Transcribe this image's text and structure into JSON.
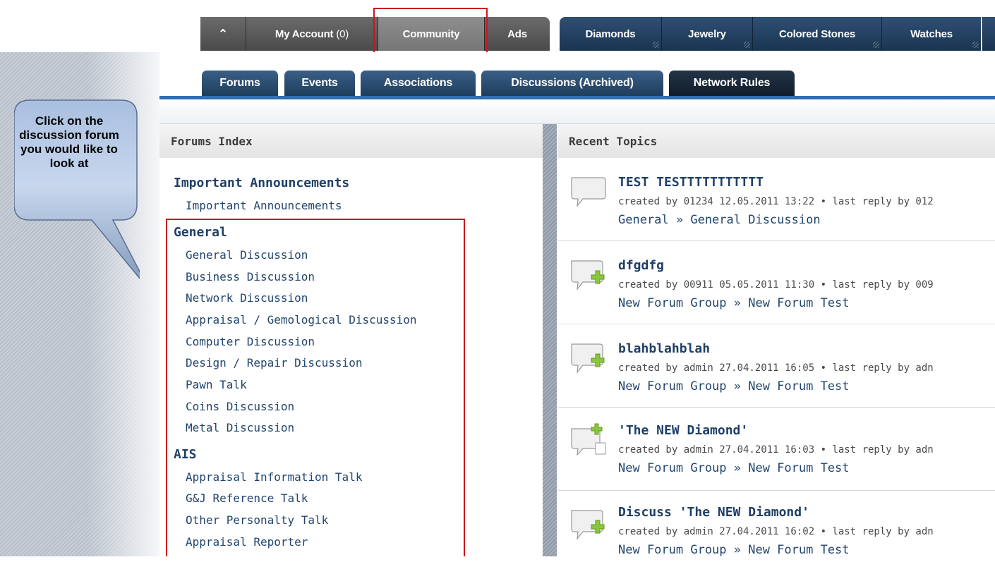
{
  "nav": {
    "my_account_label": "My Account",
    "my_account_count": "(0)",
    "community_label": "Community",
    "ads_label": "Ads",
    "diamonds_label": "Diamonds",
    "jewelry_label": "Jewelry",
    "colored_stones_label": "Colored Stones",
    "watches_label": "Watches"
  },
  "subnav": {
    "forums": "Forums",
    "events": "Events",
    "associations": "Associations",
    "discussions_archived": "Discussions (Archived)",
    "network_rules": "Network Rules"
  },
  "callout": {
    "text": "Click on the discussion forum you would like to look at"
  },
  "forums_index": {
    "heading": "Forums Index",
    "groups": [
      {
        "name": "Important Announcements",
        "items": [
          "Important Announcements"
        ]
      },
      {
        "name": "General",
        "items": [
          "General Discussion",
          "Business Discussion",
          "Network Discussion",
          "Appraisal / Gemological Discussion",
          "Computer Discussion",
          "Design / Repair Discussion",
          "Pawn Talk",
          "Coins Discussion",
          "Metal Discussion"
        ]
      },
      {
        "name": "AIS",
        "items": [
          "Appraisal Information Talk",
          "G&J Reference Talk",
          "Other Personalty Talk",
          "Appraisal Reporter"
        ]
      }
    ]
  },
  "recent": {
    "heading": "Recent Topics",
    "topics": [
      {
        "title": "TEST TESTTTTTTTTTTT",
        "meta": "created by 01234 12.05.2011 13:22 • last reply by 012",
        "crumb": "General » General Discussion"
      },
      {
        "title": "dfgdfg",
        "meta": "created by 00911 05.05.2011 11:30 • last reply by 009",
        "crumb": "New Forum Group » New Forum Test"
      },
      {
        "title": "blahblahblah",
        "meta": "created by admin 27.04.2011 16:05 • last reply by adn",
        "crumb": "New Forum Group » New Forum Test"
      },
      {
        "title": "'The NEW Diamond'",
        "meta": "created by admin 27.04.2011 16:03 • last reply by adn",
        "crumb": "New Forum Group » New Forum Test"
      },
      {
        "title": "Discuss 'The NEW Diamond'",
        "meta": "created by admin 27.04.2011 16:02 • last reply by adn",
        "crumb": "New Forum Group » New Forum Test"
      }
    ]
  },
  "colors": {
    "accent": "#c8181e",
    "nav_blue": "#1f3d5d",
    "link": "#22456e"
  }
}
